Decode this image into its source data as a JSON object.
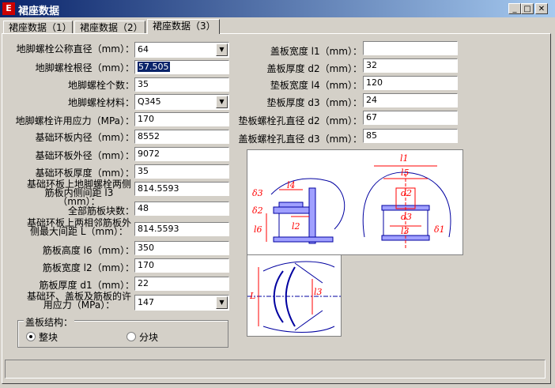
{
  "window": {
    "title": "裙座数据",
    "icon": "app-icon"
  },
  "tabs": [
    "裙座数据（1）",
    "裙座数据（2）",
    "裙座数据（3）"
  ],
  "left_fields": [
    {
      "label": "地脚螺栓公称直径（mm）：",
      "value": "64",
      "type": "select"
    },
    {
      "label": "地脚螺栓根径（mm）：",
      "value": "57.505",
      "type": "text",
      "selected": true
    },
    {
      "label": "地脚螺栓个数：",
      "value": "35",
      "type": "text"
    },
    {
      "label": "地脚螺栓材料：",
      "value": "Q345",
      "type": "select"
    },
    {
      "label": "地脚螺栓许用应力（MPa）：",
      "value": "170",
      "type": "text"
    },
    {
      "label": "基础环板内径（mm）：",
      "value": "8552",
      "type": "text"
    },
    {
      "label": "基础环板外径（mm）：",
      "value": "9072",
      "type": "text"
    },
    {
      "label": "基础环板厚度（mm）：",
      "value": "35",
      "type": "text"
    },
    {
      "label": "基础环板上地脚螺栓两侧筋板内侧间距 l3（mm）：",
      "value": "814.5593",
      "type": "text"
    },
    {
      "label": "全部筋板块数：",
      "value": "48",
      "type": "text"
    },
    {
      "label": "基础环板上两相邻筋板外侧最大间距 L（mm）：",
      "value": "814.5593",
      "type": "text"
    },
    {
      "label": "筋板高度 l6（mm）：",
      "value": "350",
      "type": "text"
    },
    {
      "label": "筋板宽度 l2（mm）：",
      "value": "170",
      "type": "text"
    },
    {
      "label": "筋板厚度 d1（mm）：",
      "value": "22",
      "type": "text"
    },
    {
      "label": "基础环、盖板及筋板的许用应力（MPa）：",
      "value": "147",
      "type": "select"
    }
  ],
  "right_fields": [
    {
      "label": "盖板宽度 l1（mm）：",
      "value": ""
    },
    {
      "label": "盖板厚度 d2（mm）：",
      "value": "32"
    },
    {
      "label": "垫板宽度 l4（mm）：",
      "value": "120"
    },
    {
      "label": "垫板厚度 d3（mm）：",
      "value": "24"
    },
    {
      "label": "垫板螺栓孔直径 d2（mm）：",
      "value": "67"
    },
    {
      "label": "盖板螺栓孔直径 d3（mm）：",
      "value": "85"
    }
  ],
  "cover_structure": {
    "title": "盖板结构：",
    "options": [
      "整块",
      "分块"
    ],
    "selected": "整块"
  },
  "diagram_labels": {
    "top": [
      "δ3",
      "l4",
      "δ2",
      "l6",
      "l2",
      "l1",
      "l5",
      "d2",
      "d3",
      "l3",
      "δ1"
    ],
    "bottom": [
      "L",
      "l3"
    ]
  },
  "colors": {
    "title_start": "#0a246a",
    "title_end": "#a6caf0",
    "drawing_blue": "#0000a0",
    "drawing_red": "#ff0000"
  }
}
